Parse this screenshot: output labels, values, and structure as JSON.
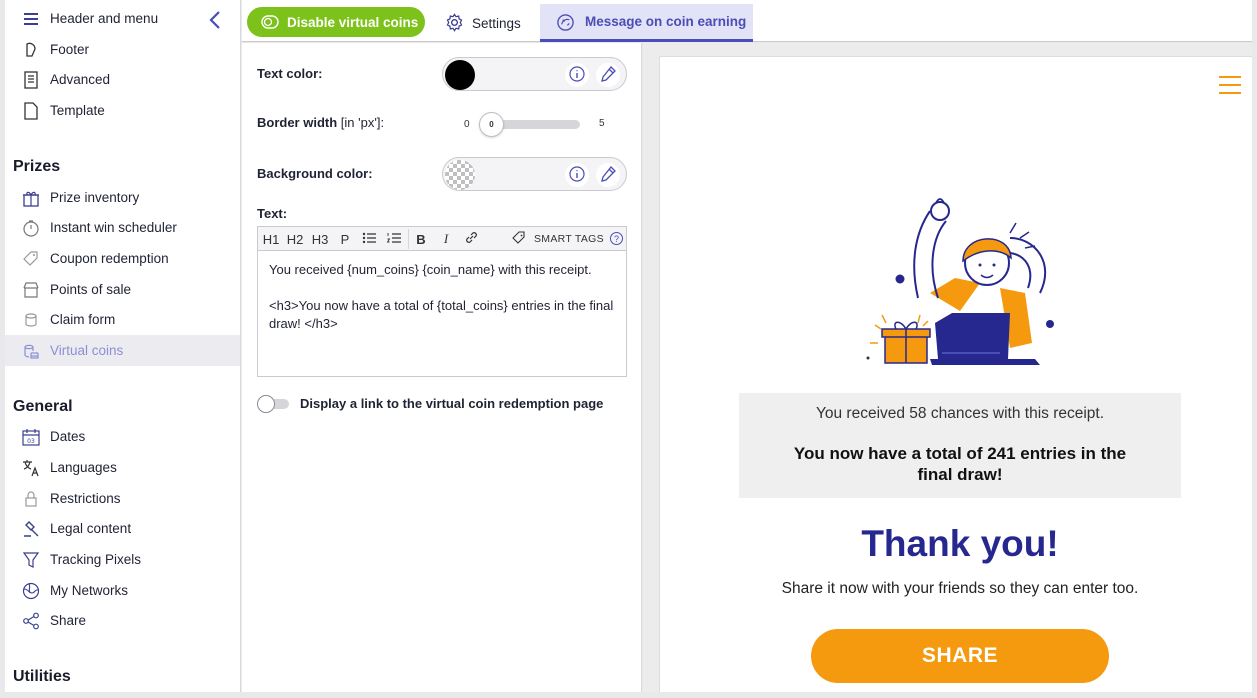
{
  "sidebar": {
    "top_items": [
      {
        "label": "Header and menu",
        "icon": "menu-lines-icon"
      },
      {
        "label": "Footer",
        "icon": "footer-icon"
      },
      {
        "label": "Advanced",
        "icon": "advanced-icon"
      },
      {
        "label": "Template",
        "icon": "template-icon"
      }
    ],
    "prizes_title": "Prizes",
    "prizes_items": [
      {
        "label": "Prize inventory",
        "icon": "gift-icon"
      },
      {
        "label": "Instant win scheduler",
        "icon": "stopwatch-icon"
      },
      {
        "label": "Coupon redemption",
        "icon": "coupon-icon"
      },
      {
        "label": "Points of sale",
        "icon": "store-icon"
      },
      {
        "label": "Claim form",
        "icon": "claim-form-icon"
      },
      {
        "label": "Virtual coins",
        "icon": "coins-icon",
        "active": true
      }
    ],
    "general_title": "General",
    "general_items": [
      {
        "label": "Dates",
        "icon": "calendar-icon"
      },
      {
        "label": "Languages",
        "icon": "language-icon"
      },
      {
        "label": "Restrictions",
        "icon": "lock-icon"
      },
      {
        "label": "Legal content",
        "icon": "gavel-icon"
      },
      {
        "label": "Tracking Pixels",
        "icon": "filter-icon"
      },
      {
        "label": "My Networks",
        "icon": "globe-icon"
      },
      {
        "label": "Share",
        "icon": "share-icon"
      }
    ],
    "utilities_title": "Utilities"
  },
  "topbar": {
    "disable_label": "Disable virtual coins",
    "settings_tab": "Settings",
    "message_tab": "Message on coin earning"
  },
  "panel": {
    "text_color_label": "Text color:",
    "border_width_label": "Border width",
    "border_width_unit": "[in 'px']:",
    "slider_min": "0",
    "slider_max": "5",
    "slider_value": "0",
    "background_color_label": "Background color:",
    "text_label": "Text:",
    "toolbar": {
      "h1": "H1",
      "h2": "H2",
      "h3": "H3",
      "p": "P",
      "bold": "B",
      "italic": "I",
      "smart_tags": "SMART TAGS",
      "help": "?"
    },
    "editor_line1": "You received {num_coins} {coin_name} with this receipt.",
    "editor_line2": "<h3>You now have a total of {total_coins} entries in the final draw! </h3>",
    "toggle_label": "Display a link to the virtual coin redemption page",
    "toggle_on": false
  },
  "preview": {
    "message_line1": "You received 58 chances with this receipt.",
    "message_line2": "You now have a total of 241 entries in the final draw!",
    "thank_you": "Thank you!",
    "share_note": "Share it now with your friends so they can enter too.",
    "share_button": "SHARE"
  },
  "colors": {
    "accent": "#4a4db5",
    "green": "#7cc21b",
    "orange": "#f59a0f",
    "navy": "#26288f"
  }
}
